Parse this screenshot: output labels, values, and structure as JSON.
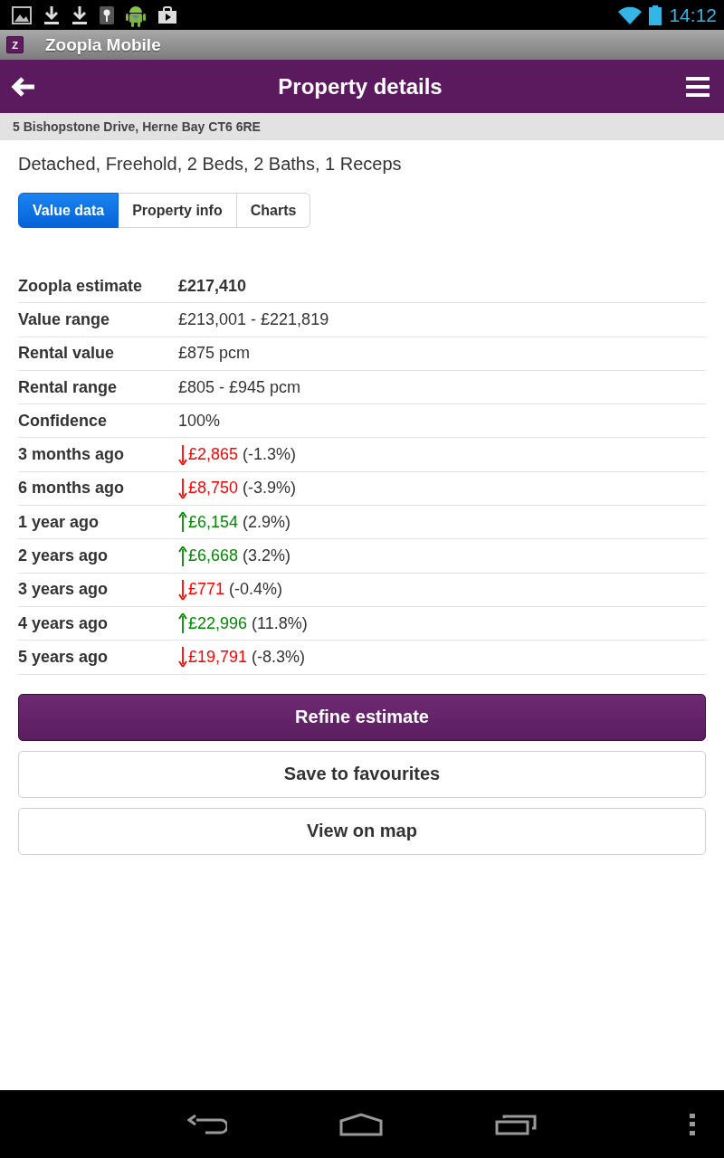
{
  "status_bar": {
    "time": "14:12"
  },
  "app_bar": {
    "logo_text": "Z",
    "title": "Zoopla Mobile"
  },
  "header": {
    "title": "Property details"
  },
  "address": "5 Bishopstone Drive, Herne Bay CT6 6RE",
  "summary": "Detached, Freehold, 2 Beds, 2 Baths, 1 Receps",
  "tabs": [
    {
      "label": "Value data",
      "selected": true
    },
    {
      "label": "Property info",
      "selected": false
    },
    {
      "label": "Charts",
      "selected": false
    }
  ],
  "rows": [
    {
      "kind": "estimate",
      "label": "Zoopla estimate",
      "value": "£217,410"
    },
    {
      "kind": "text",
      "label": "Value range",
      "value": "£213,001 - £221,819"
    },
    {
      "kind": "text",
      "label": "Rental value",
      "value": "£875 pcm"
    },
    {
      "kind": "text",
      "label": "Rental range",
      "value": "£805 - £945 pcm"
    },
    {
      "kind": "text",
      "label": "Confidence",
      "value": "100%"
    },
    {
      "kind": "change",
      "label": "3 months ago",
      "rising": false,
      "amount": "£2,865",
      "percent": "(-1.3%)"
    },
    {
      "kind": "change",
      "label": "6 months ago",
      "rising": false,
      "amount": "£8,750",
      "percent": "(-3.9%)"
    },
    {
      "kind": "change",
      "label": "1 year ago",
      "rising": true,
      "amount": "£6,154",
      "percent": "(2.9%)"
    },
    {
      "kind": "change",
      "label": "2 years ago",
      "rising": true,
      "amount": "£6,668",
      "percent": "(3.2%)"
    },
    {
      "kind": "change",
      "label": "3 years ago",
      "rising": false,
      "amount": "£771",
      "percent": "(-0.4%)"
    },
    {
      "kind": "change",
      "label": "4 years ago",
      "rising": true,
      "amount": "£22,996",
      "percent": "(11.8%)"
    },
    {
      "kind": "change",
      "label": "5 years ago",
      "rising": false,
      "amount": "£19,791",
      "percent": "(-8.3%)"
    }
  ],
  "buttons": [
    {
      "kind": "primary",
      "label": "Refine estimate"
    },
    {
      "kind": "secondary",
      "label": "Save to favourites"
    },
    {
      "kind": "secondary",
      "label": "View on map"
    }
  ]
}
